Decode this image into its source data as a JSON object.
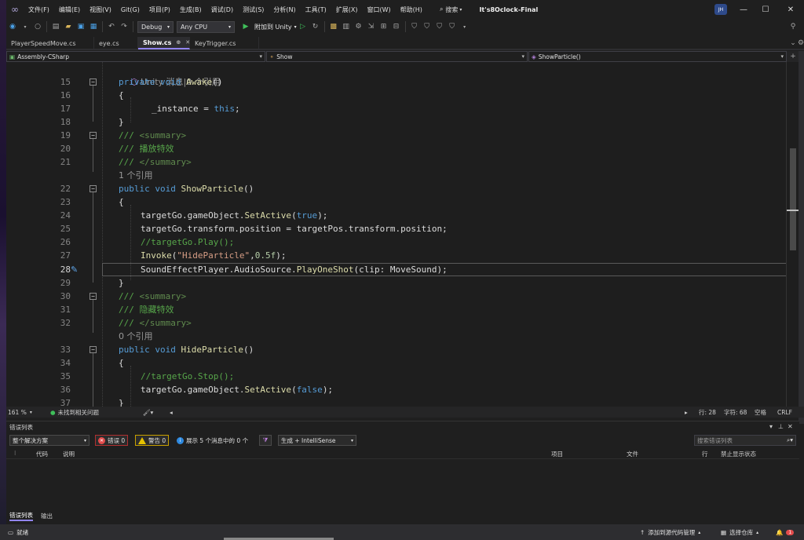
{
  "menubar": {
    "items": [
      "文件(F)",
      "编辑(E)",
      "视图(V)",
      "Git(G)",
      "项目(P)",
      "生成(B)",
      "调试(D)",
      "测试(S)",
      "分析(N)",
      "工具(T)",
      "扩展(X)",
      "窗口(W)",
      "帮助(H)"
    ],
    "search_label": "搜索",
    "project_title": "It's8Oclock-Final",
    "avatar_initials": "JH"
  },
  "toolbar": {
    "config": "Debug",
    "platform": "Any CPU",
    "attach_label": "附加到 Unity"
  },
  "tabs": [
    {
      "label": "PlayerSpeedMove.cs",
      "active": false
    },
    {
      "label": "eye.cs",
      "active": false
    },
    {
      "label": "Show.cs",
      "active": true
    },
    {
      "label": "KeyTrigger.cs",
      "active": false
    }
  ],
  "navbar": {
    "project": "Assembly-CSharp",
    "class": "Show",
    "member": "ShowParticle()"
  },
  "code": {
    "lens_unity": "Unity 消息|0 个引用",
    "lines": {
      "l15": {
        "n": "15",
        "a": "private void ",
        "b": "Awake",
        "c": "()"
      },
      "l16": {
        "n": "16",
        "a": "{"
      },
      "l17": {
        "n": "17",
        "a": "_instance = ",
        "b": "this",
        "c": ";"
      },
      "l18": {
        "n": "18",
        "a": "}"
      },
      "l19": {
        "n": "19",
        "a": "/// ",
        "b": "<summary>"
      },
      "l20": {
        "n": "20",
        "a": "/// 播放特效"
      },
      "l21": {
        "n": "21",
        "a": "/// ",
        "b": "</summary>"
      },
      "lens1": "1 个引用",
      "l22": {
        "n": "22",
        "a": "public void ",
        "b": "ShowParticle",
        "c": "()"
      },
      "l23": {
        "n": "23",
        "a": "{"
      },
      "l24": {
        "n": "24",
        "a": "targetGo.gameObject.",
        "b": "SetActive",
        "c": "(",
        "d": "true",
        "e": ");"
      },
      "l25": {
        "n": "25",
        "a": "targetGo.transform.position = targetPos.transform.position;"
      },
      "l26": {
        "n": "26",
        "a": "//targetGo.Play();"
      },
      "l27": {
        "n": "27",
        "a": "Invoke",
        "b": "(",
        "c": "\"HideParticle\"",
        "d": ",",
        "e": "0.5f",
        "f": ");"
      },
      "l28": {
        "n": "28",
        "a": "SoundEffectPlayer.AudioSource.",
        "b": "PlayOneShot",
        "c": "(clip: MoveSound);"
      },
      "l29": {
        "n": "29",
        "a": "}"
      },
      "l30": {
        "n": "30",
        "a": "/// ",
        "b": "<summary>"
      },
      "l31": {
        "n": "31",
        "a": "/// 隐藏特效"
      },
      "l32": {
        "n": "32",
        "a": "/// ",
        "b": "</summary>"
      },
      "lens0": "0 个引用",
      "l33": {
        "n": "33",
        "a": "public void ",
        "b": "HideParticle",
        "c": "()"
      },
      "l34": {
        "n": "34",
        "a": "{"
      },
      "l35": {
        "n": "35",
        "a": "//targetGo.Stop();"
      },
      "l36": {
        "n": "36",
        "a": "targetGo.gameObject.",
        "b": "SetActive",
        "c": "(",
        "d": "false",
        "e": ");"
      },
      "l37": {
        "n": "37",
        "a": "}"
      }
    }
  },
  "editor_status": {
    "zoom": "161 %",
    "issues": "未找到相关问题",
    "line": "行: 28",
    "char": "字符: 68",
    "whitespace": "空格",
    "eol": "CRLF"
  },
  "error_list": {
    "title": "错误列表",
    "scope": "整个解决方案",
    "errors": "错误 0",
    "warnings": "警告 0",
    "messages": "展示 5 个消息中的 0 个",
    "build_filter": "生成 + IntelliSense",
    "search_placeholder": "搜索错误列表",
    "columns": {
      "code": "代码",
      "desc": "说明",
      "project": "项目",
      "file": "文件",
      "line": "行",
      "suppress": "禁止显示状态"
    }
  },
  "bottom_tabs": [
    "错误列表",
    "输出"
  ],
  "statusbar": {
    "ready": "就绪",
    "add_source": "添加到源代码管理",
    "select_repo": "选择仓库",
    "notifications": "1"
  },
  "colors": {
    "accent": "#9184ee",
    "keyword": "#569cd6",
    "comment": "#57a64a",
    "method": "#dcdcaa",
    "string": "#d69d85"
  }
}
